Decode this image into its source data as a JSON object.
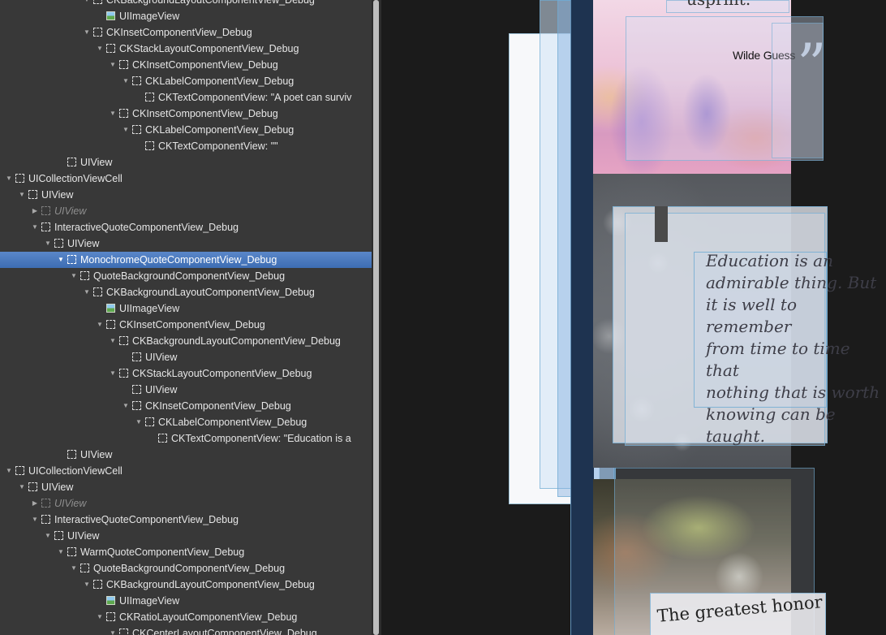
{
  "hierarchy": {
    "rows": [
      {
        "depth": 6,
        "expand": "open",
        "icon": "view",
        "label": "CKBackgroundLayoutComponentView_Debug"
      },
      {
        "depth": 7,
        "expand": "none",
        "icon": "image",
        "label": "UIImageView"
      },
      {
        "depth": 6,
        "expand": "open",
        "icon": "view",
        "label": "CKInsetComponentView_Debug"
      },
      {
        "depth": 7,
        "expand": "open",
        "icon": "view",
        "label": "CKStackLayoutComponentView_Debug"
      },
      {
        "depth": 8,
        "expand": "open",
        "icon": "view",
        "label": "CKInsetComponentView_Debug"
      },
      {
        "depth": 9,
        "expand": "open",
        "icon": "view",
        "label": "CKLabelComponentView_Debug"
      },
      {
        "depth": 10,
        "expand": "none",
        "icon": "view",
        "label": "CKTextComponentView: \"A poet can surviv"
      },
      {
        "depth": 8,
        "expand": "open",
        "icon": "view",
        "label": "CKInsetComponentView_Debug"
      },
      {
        "depth": 9,
        "expand": "open",
        "icon": "view",
        "label": "CKLabelComponentView_Debug"
      },
      {
        "depth": 10,
        "expand": "none",
        "icon": "view",
        "label": "CKTextComponentView: \"\""
      },
      {
        "depth": 4,
        "expand": "none",
        "icon": "view",
        "label": "UIView"
      },
      {
        "depth": 0,
        "expand": "open",
        "icon": "view",
        "label": "UICollectionViewCell"
      },
      {
        "depth": 1,
        "expand": "open",
        "icon": "view",
        "label": "UIView"
      },
      {
        "depth": 2,
        "expand": "closed",
        "icon": "view",
        "label": "UIView",
        "hidden": true
      },
      {
        "depth": 2,
        "expand": "open",
        "icon": "view",
        "label": "InteractiveQuoteComponentView_Debug"
      },
      {
        "depth": 3,
        "expand": "open",
        "icon": "view",
        "label": "UIView"
      },
      {
        "depth": 4,
        "expand": "open",
        "icon": "view",
        "label": "MonochromeQuoteComponentView_Debug",
        "selected": true
      },
      {
        "depth": 5,
        "expand": "open",
        "icon": "view",
        "label": "QuoteBackgroundComponentView_Debug"
      },
      {
        "depth": 6,
        "expand": "open",
        "icon": "view",
        "label": "CKBackgroundLayoutComponentView_Debug"
      },
      {
        "depth": 7,
        "expand": "none",
        "icon": "image",
        "label": "UIImageView"
      },
      {
        "depth": 7,
        "expand": "open",
        "icon": "view",
        "label": "CKInsetComponentView_Debug"
      },
      {
        "depth": 8,
        "expand": "open",
        "icon": "view",
        "label": "CKBackgroundLayoutComponentView_Debug"
      },
      {
        "depth": 9,
        "expand": "none",
        "icon": "view",
        "label": "UIView"
      },
      {
        "depth": 8,
        "expand": "open",
        "icon": "view",
        "label": "CKStackLayoutComponentView_Debug"
      },
      {
        "depth": 9,
        "expand": "none",
        "icon": "view",
        "label": "UIView"
      },
      {
        "depth": 9,
        "expand": "open",
        "icon": "view",
        "label": "CKInsetComponentView_Debug"
      },
      {
        "depth": 10,
        "expand": "open",
        "icon": "view",
        "label": "CKLabelComponentView_Debug"
      },
      {
        "depth": 11,
        "expand": "none",
        "icon": "view",
        "label": "CKTextComponentView: \"Education is a"
      },
      {
        "depth": 4,
        "expand": "none",
        "icon": "view",
        "label": "UIView"
      },
      {
        "depth": 0,
        "expand": "open",
        "icon": "view",
        "label": "UICollectionViewCell"
      },
      {
        "depth": 1,
        "expand": "open",
        "icon": "view",
        "label": "UIView"
      },
      {
        "depth": 2,
        "expand": "closed",
        "icon": "view",
        "label": "UIView",
        "hidden": true
      },
      {
        "depth": 2,
        "expand": "open",
        "icon": "view",
        "label": "InteractiveQuoteComponentView_Debug"
      },
      {
        "depth": 3,
        "expand": "open",
        "icon": "view",
        "label": "UIView"
      },
      {
        "depth": 4,
        "expand": "open",
        "icon": "view",
        "label": "WarmQuoteComponentView_Debug"
      },
      {
        "depth": 5,
        "expand": "open",
        "icon": "view",
        "label": "QuoteBackgroundComponentView_Debug"
      },
      {
        "depth": 6,
        "expand": "open",
        "icon": "view",
        "label": "CKBackgroundLayoutComponentView_Debug"
      },
      {
        "depth": 7,
        "expand": "none",
        "icon": "image",
        "label": "UIImageView"
      },
      {
        "depth": 7,
        "expand": "open",
        "icon": "view",
        "label": "CKRatioLayoutComponentView_Debug"
      },
      {
        "depth": 8,
        "expand": "open",
        "icon": "view",
        "label": "CKCenterLayoutComponentView_Debug"
      }
    ]
  },
  "canvas": {
    "top_card_text": "usprint.",
    "author": "Wilde Guess",
    "quote_mark": "”",
    "quote_text": "Education is an\nadmirable thing. But\nit is well to remember\nfrom time to time that\nnothing that is worth\nknowing can be\ntaught.",
    "bottom_text": "The greatest honor"
  }
}
